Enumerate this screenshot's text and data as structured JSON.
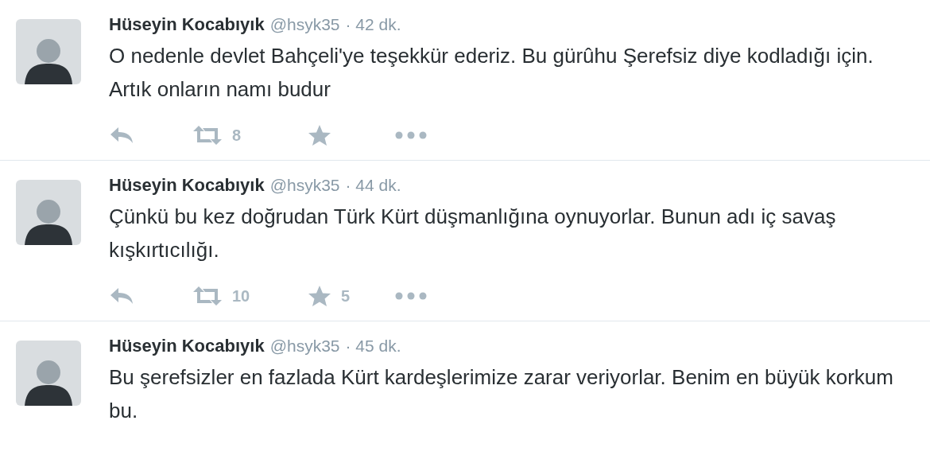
{
  "tweets": [
    {
      "name": "Hüseyin Kocabıyık",
      "handle": "@hsyk35",
      "time": "· 42 dk.",
      "text": "O nedenle devlet Bahçeli'ye teşekkür ederiz. Bu gürûhu Şerefsiz diye kodladığı için. Artık onların namı budur",
      "actions": [
        {
          "kind": "reply"
        },
        {
          "kind": "retweet",
          "count": "8"
        },
        {
          "kind": "like"
        },
        {
          "kind": "more"
        }
      ]
    },
    {
      "name": "Hüseyin Kocabıyık",
      "handle": "@hsyk35",
      "time": "· 44 dk.",
      "text": "Çünkü bu kez doğrudan Türk Kürt düşmanlığına oynuyorlar. Bunun adı iç savaş kışkırtıcılığı.",
      "actions": [
        {
          "kind": "reply"
        },
        {
          "kind": "retweet",
          "count": "10"
        },
        {
          "kind": "like",
          "count": "5"
        },
        {
          "kind": "more"
        }
      ]
    },
    {
      "name": "Hüseyin Kocabıyık",
      "handle": "@hsyk35",
      "time": "· 45 dk.",
      "text": "Bu şerefsizler en fazlada Kürt kardeşlerimize zarar veriyorlar. Benim en büyük korkum bu."
    }
  ]
}
